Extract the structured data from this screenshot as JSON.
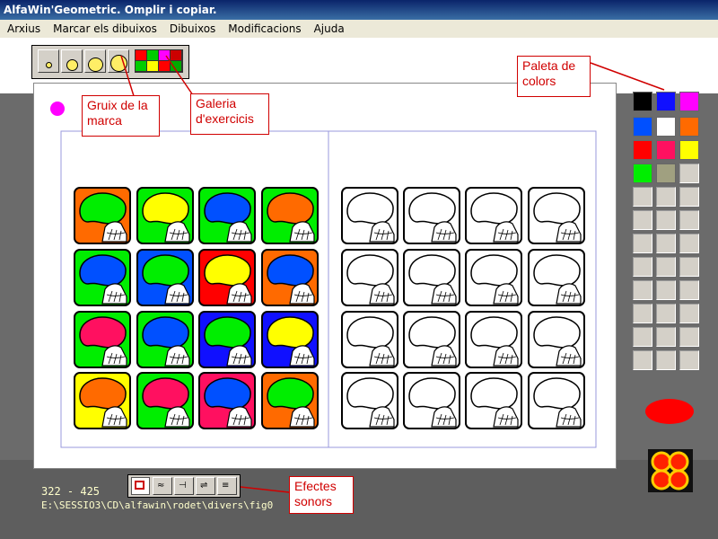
{
  "window": {
    "title": "AlfaWin'Geometric. Omplir i copiar."
  },
  "menu": [
    "Arxius",
    "Marcar els dibuixos",
    "Dibuixos",
    "Modificacions",
    "Ajuda"
  ],
  "callouts": {
    "gruix": "Gruix de la marca",
    "galeria": "Galeria d'exercicis",
    "paleta": "Paleta de colors",
    "efectes": "Efectes sonors"
  },
  "status": {
    "coords": "322 - 425",
    "path": "E:\\SESSIO3\\CD\\alfawin\\rodet\\divers\\fig0"
  },
  "colors": {
    "current_marker": "#ff00ff",
    "palette": [
      "#000000",
      "#1010ff",
      "#ff00ff",
      "#0050ff",
      "#ffffff",
      "#ff6a00",
      "#ff0000",
      "#ff1060",
      "#ffff00",
      "#00ee00",
      "#a0a080"
    ],
    "selected_oval": "#ff0000"
  },
  "model_tiles": [
    {
      "bg": "#ff6a00",
      "lemon": "#00ee00"
    },
    {
      "bg": "#00ee00",
      "lemon": "#ffff00"
    },
    {
      "bg": "#00ee00",
      "lemon": "#0050ff"
    },
    {
      "bg": "#00ee00",
      "lemon": "#ff6a00"
    },
    {
      "bg": "#00ee00",
      "lemon": "#0050ff"
    },
    {
      "bg": "#0050ff",
      "lemon": "#00ee00"
    },
    {
      "bg": "#ff0000",
      "lemon": "#ffff00"
    },
    {
      "bg": "#ff6a00",
      "lemon": "#0050ff"
    },
    {
      "bg": "#00ee00",
      "lemon": "#ff1060"
    },
    {
      "bg": "#00ee00",
      "lemon": "#0050ff"
    },
    {
      "bg": "#1010ff",
      "lemon": "#00ee00"
    },
    {
      "bg": "#1010ff",
      "lemon": "#ffff00"
    },
    {
      "bg": "#ffff00",
      "lemon": "#ff6a00"
    },
    {
      "bg": "#00ee00",
      "lemon": "#ff1060"
    },
    {
      "bg": "#ff1060",
      "lemon": "#0050ff"
    },
    {
      "bg": "#ff6a00",
      "lemon": "#00ee00"
    }
  ],
  "icons": {
    "toolbar_thickness": [
      "thickness-1-icon",
      "thickness-2-icon",
      "thickness-3-icon",
      "thickness-4-icon"
    ],
    "gallery": "exercise-gallery-icon",
    "sound_buttons": [
      "sound-stop-icon",
      "sound-effect-1-icon",
      "sound-effect-2-icon",
      "sound-effect-3-icon",
      "sound-effect-4-icon"
    ],
    "logo": "alfawin-logo-icon"
  }
}
